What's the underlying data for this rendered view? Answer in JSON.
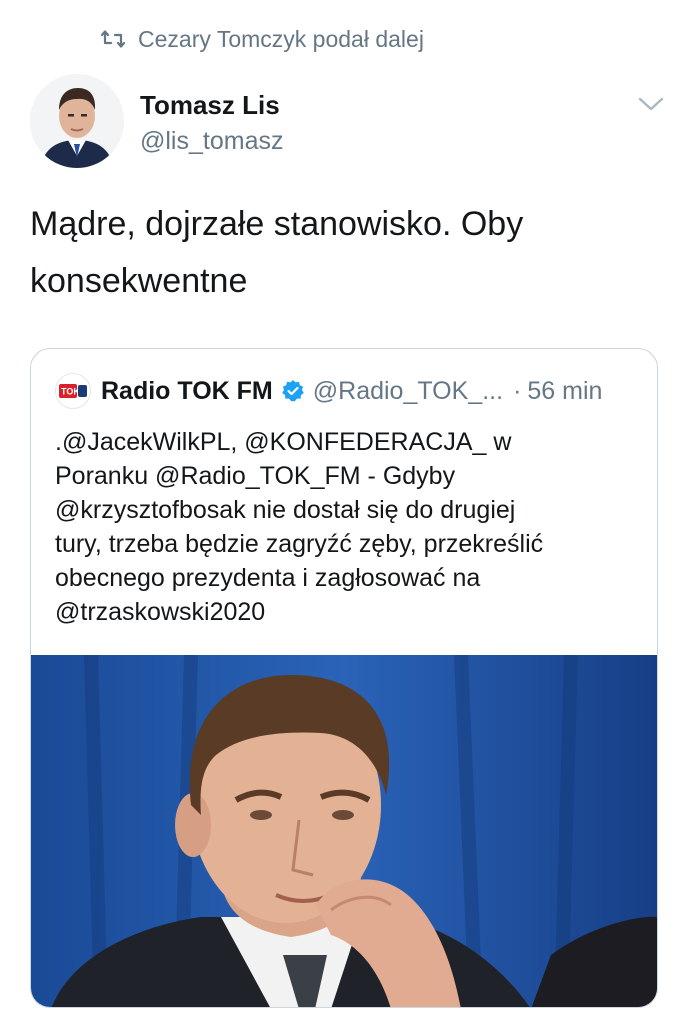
{
  "retweet": {
    "icon": "retweet-icon",
    "text": "Cezary Tomczyk podał dalej"
  },
  "author": {
    "name": "Tomasz Lis",
    "handle": "@lis_tomasz",
    "avatar": "author-avatar"
  },
  "tweet": {
    "text": "Mądre, dojrzałe stanowisko. Oby konsekwentne"
  },
  "quoted": {
    "logo": "tokfm-logo",
    "name": "Radio TOK FM",
    "verified": true,
    "handle": "@Radio_TOK_...",
    "separator": "·",
    "time": "56 min",
    "text": ".@JacekWilkPL, @KONFEDERACJA_ w\nPoranku @Radio_TOK_FM - Gdyby\n@krzysztofbosak  nie dostał się do drugiej\ntury, trzeba będzie zagryźć zęby, przekreślić\nobecnego prezydenta i zagłosować na\n@trzaskowski2020",
    "media": "photo-man-blue-background"
  },
  "colors": {
    "text": "#14171a",
    "secondary": "#657786",
    "border": "#ccd6dd",
    "verified": "#1da1f2",
    "media_bg": "#1c4f9c"
  }
}
